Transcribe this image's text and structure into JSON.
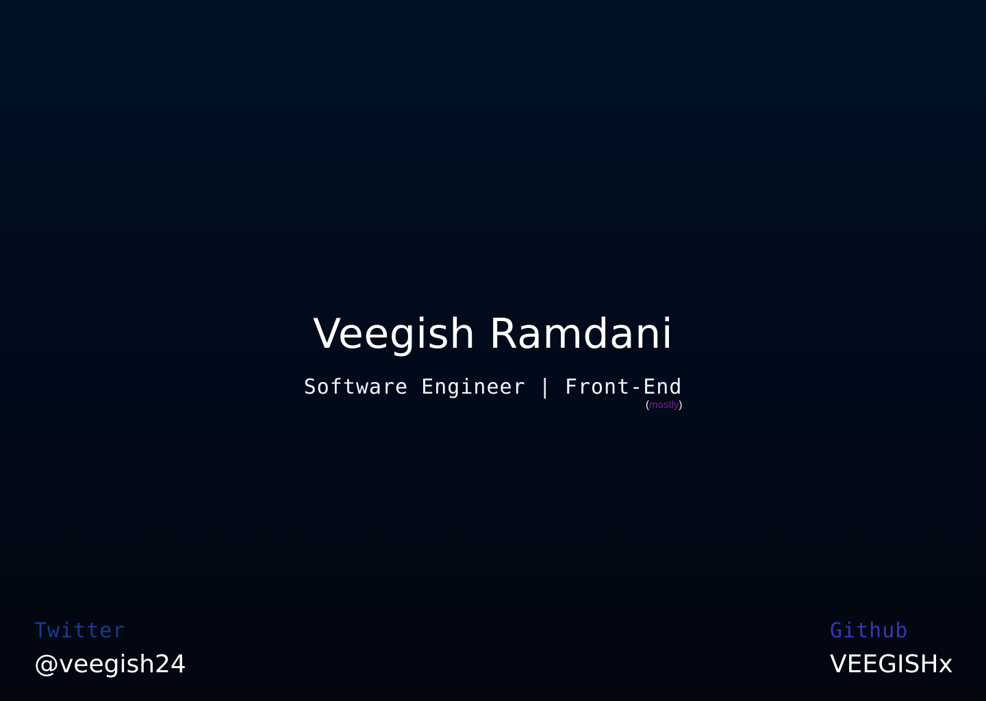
{
  "hero": {
    "name": "Veegish Ramdani",
    "role": "Software Engineer | Front-End",
    "note_open": "(",
    "note_word": "mostly",
    "note_close": ")"
  },
  "social": {
    "twitter": {
      "label": "Twitter",
      "handle": "@veegish24"
    },
    "github": {
      "label": "Github",
      "handle": "VEEGISHx"
    }
  },
  "colors": {
    "background_top": "#001326",
    "background_bottom": "#02060f",
    "twitter_accent": "#1b3a8f",
    "github_accent": "#3a35b8",
    "mostly_accent": "#7a1f8f"
  }
}
